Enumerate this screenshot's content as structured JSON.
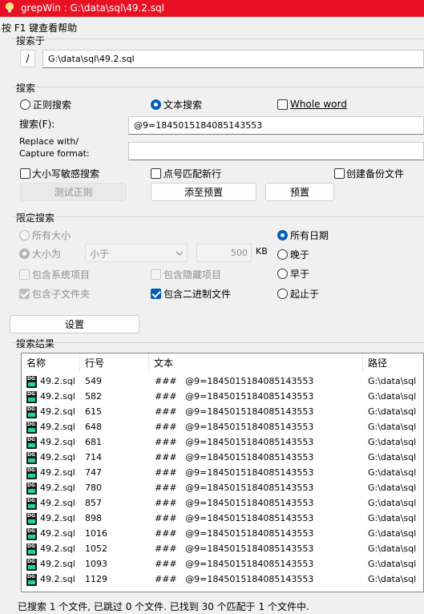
{
  "window": {
    "title": "grepWin : G:\\data\\sql\\49.2.sql"
  },
  "help_text": "按 F1 键查看帮助",
  "search_in": {
    "group_label": "搜索于",
    "browse_button": "/",
    "path": "G:\\data\\sql\\49.2.sql"
  },
  "search": {
    "group_label": "搜索",
    "regex_label": "正则搜索",
    "text_label": "文本搜索",
    "whole_word_label": "Whole word",
    "search_label": "搜索(F):",
    "search_value": "@9=1845015184085143553",
    "replace_label_line1": "Replace with/",
    "replace_label_line2": "Capture format:",
    "replace_value": "",
    "case_sensitive_label": "大小写敏感搜索",
    "dot_newline_label": "点号匹配新行",
    "backup_label": "创建备份文件",
    "test_regex_button": "测试正则",
    "add_preset_button": "添至预置",
    "preset_button": "预置"
  },
  "limit": {
    "group_label": "限定搜索",
    "all_sizes_label": "所有大小",
    "size_is_label": "大小为",
    "size_op": "小于",
    "size_value": "500",
    "size_unit": "KB",
    "include_system_label": "包含系统项目",
    "include_hidden_label": "包含隐藏项目",
    "include_subfolders_label": "包含子文件夹",
    "include_binary_label": "包含二进制文件",
    "all_dates_label": "所有日期",
    "newer_label": "晚于",
    "older_label": "早于",
    "between_label": "起止于",
    "settings_button": "设置"
  },
  "results": {
    "group_label": "搜索结果",
    "columns": [
      "名称",
      "行号",
      "文本",
      "路径"
    ],
    "rows": [
      {
        "name": "49.2.sql",
        "line": "549",
        "text": "###   @9=1845015184085143553",
        "path": "G:\\data\\sql"
      },
      {
        "name": "49.2.sql",
        "line": "582",
        "text": "###   @9=1845015184085143553",
        "path": "G:\\data\\sql"
      },
      {
        "name": "49.2.sql",
        "line": "615",
        "text": "###   @9=1845015184085143553",
        "path": "G:\\data\\sql"
      },
      {
        "name": "49.2.sql",
        "line": "648",
        "text": "###   @9=1845015184085143553",
        "path": "G:\\data\\sql"
      },
      {
        "name": "49.2.sql",
        "line": "681",
        "text": "###   @9=1845015184085143553",
        "path": "G:\\data\\sql"
      },
      {
        "name": "49.2.sql",
        "line": "714",
        "text": "###   @9=1845015184085143553",
        "path": "G:\\data\\sql"
      },
      {
        "name": "49.2.sql",
        "line": "747",
        "text": "###   @9=1845015184085143553",
        "path": "G:\\data\\sql"
      },
      {
        "name": "49.2.sql",
        "line": "780",
        "text": "###   @9=1845015184085143553",
        "path": "G:\\data\\sql"
      },
      {
        "name": "49.2.sql",
        "line": "857",
        "text": "###   @9=1845015184085143553",
        "path": "G:\\data\\sql"
      },
      {
        "name": "49.2.sql",
        "line": "898",
        "text": "###   @9=1845015184085143553",
        "path": "G:\\data\\sql"
      },
      {
        "name": "49.2.sql",
        "line": "1016",
        "text": "###   @9=1845015184085143553",
        "path": "G:\\data\\sql"
      },
      {
        "name": "49.2.sql",
        "line": "1052",
        "text": "###   @9=1845015184085143553",
        "path": "G:\\data\\sql"
      },
      {
        "name": "49.2.sql",
        "line": "1093",
        "text": "###   @9=1845015184085143553",
        "path": "G:\\data\\sql"
      },
      {
        "name": "49.2.sql",
        "line": "1129",
        "text": "###   @9=1845015184085143553",
        "path": "G:\\data\\sql"
      }
    ]
  },
  "status_text": "已搜索 1 个文件, 已跳过 0 个文件. 已找到 30 个匹配于 1 个文件中.",
  "colors": {
    "titlebar": "#e81123",
    "accent": "#005fb8"
  },
  "icons": {
    "app": "lightbulb-icon",
    "file": "datagrip-file-icon",
    "dropdown": "chevron-down-icon"
  }
}
